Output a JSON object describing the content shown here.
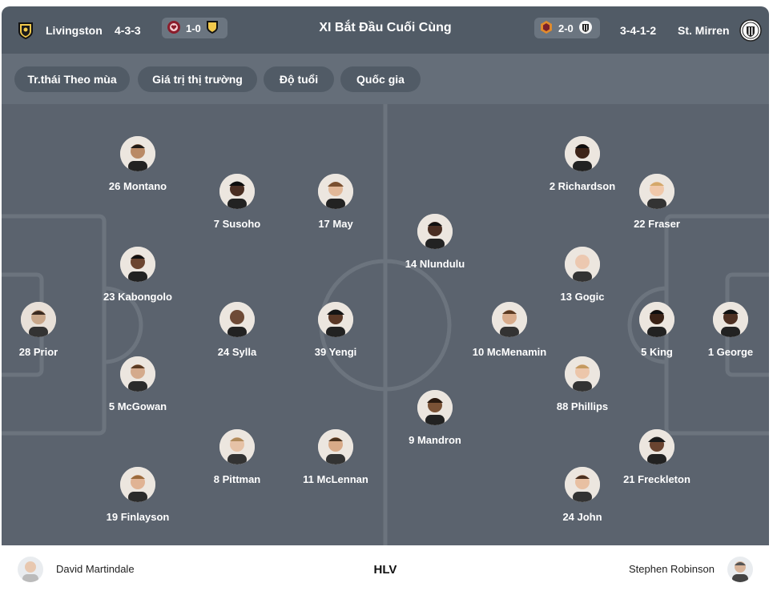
{
  "header": {
    "title": "XI Bắt Đầu Cuối Cùng",
    "home": {
      "name": "Livingston",
      "formation": "4-3-3",
      "last_result": "1-0"
    },
    "away": {
      "name": "St. Mirren",
      "formation": "3-4-1-2",
      "last_result": "2-0"
    }
  },
  "filters": [
    {
      "label": "Tr.thái Theo mùa"
    },
    {
      "label": "Giá trị thị trường"
    },
    {
      "label": "Độ tuổi"
    },
    {
      "label": "Quốc gia"
    }
  ],
  "home_players": [
    {
      "name": "28 Prior"
    },
    {
      "name": "26 Montano"
    },
    {
      "name": "23 Kabongolo"
    },
    {
      "name": "5 McGowan"
    },
    {
      "name": "19 Finlayson"
    },
    {
      "name": "7 Susoho"
    },
    {
      "name": "24 Sylla"
    },
    {
      "name": "8 Pittman"
    },
    {
      "name": "17 May"
    },
    {
      "name": "39 Yengi"
    },
    {
      "name": "11 McLennan"
    }
  ],
  "away_players": [
    {
      "name": "14 Nlundulu"
    },
    {
      "name": "9 Mandron"
    },
    {
      "name": "10 McMenamin"
    },
    {
      "name": "2 Richardson"
    },
    {
      "name": "13 Gogic"
    },
    {
      "name": "88 Phillips"
    },
    {
      "name": "24 John"
    },
    {
      "name": "22 Fraser"
    },
    {
      "name": "5 King"
    },
    {
      "name": "21 Freckleton"
    },
    {
      "name": "1 George"
    }
  ],
  "coaches": {
    "label": "HLV",
    "home": "David Martindale",
    "away": "Stephen Robinson"
  },
  "colors": {
    "header_bg": "#515b66",
    "filter_bar_bg": "#656e79",
    "pitch_bg": "#5b636e",
    "pitch_lines": "#6c747e"
  }
}
